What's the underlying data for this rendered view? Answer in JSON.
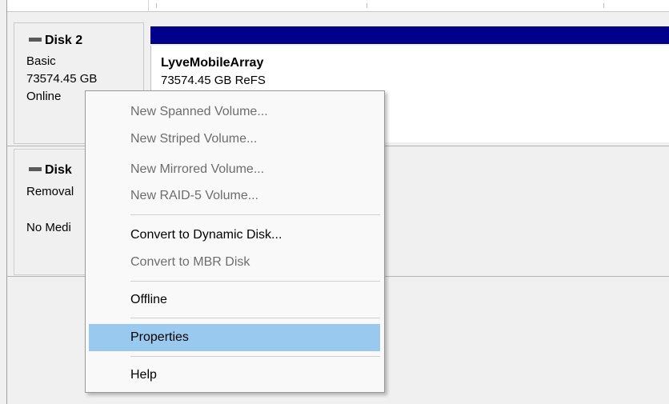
{
  "disk2": {
    "title": "Disk 2",
    "type": "Basic",
    "size": "73574.45 GB",
    "status": "Online",
    "volume": {
      "name": "LyveMobileArray",
      "detail": "73574.45 GB ReFS",
      "header_color": "#00008b"
    }
  },
  "disk3": {
    "title": "Disk",
    "type": "Removal",
    "status": "No Medi"
  },
  "context_menu": {
    "items": [
      {
        "label": "New Spanned Volume...",
        "enabled": false
      },
      {
        "label": "New Striped Volume...",
        "enabled": false
      },
      {
        "label": "New Mirrored Volume...",
        "enabled": false
      },
      {
        "label": "New RAID-5 Volume...",
        "enabled": false
      },
      {
        "label": "Convert to Dynamic Disk...",
        "enabled": true
      },
      {
        "label": "Convert to MBR Disk",
        "enabled": false
      },
      {
        "label": "Offline",
        "enabled": true
      },
      {
        "label": "Properties",
        "enabled": true,
        "highlighted": true
      },
      {
        "label": "Help",
        "enabled": true
      }
    ],
    "highlight_color": "#99c9ef"
  }
}
